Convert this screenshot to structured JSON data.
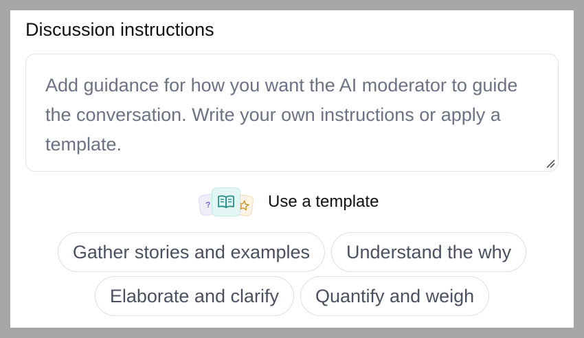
{
  "section": {
    "title": "Discussion instructions"
  },
  "instructions": {
    "value": "",
    "placeholder": "Add guidance for how you want the AI moderator to guide the conversation. Write your own instructions or apply a template."
  },
  "templates": {
    "label": "Use a template",
    "icons": [
      "question-card-icon",
      "open-book-icon",
      "star-card-icon"
    ],
    "question_glyph": "?",
    "options": [
      "Gather stories and examples",
      "Understand the why",
      "Elaborate and clarify",
      "Quantify and weigh"
    ]
  },
  "colors": {
    "backdrop": "#a6a6a6",
    "book_accent": "#2a8f87",
    "star_accent": "#c89124",
    "question_accent": "#7c63d8"
  }
}
